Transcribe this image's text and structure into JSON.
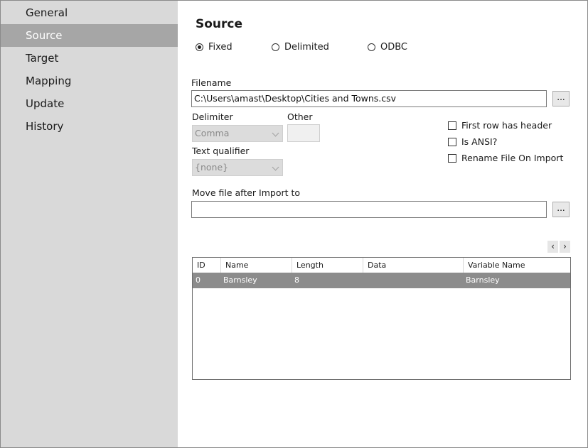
{
  "sidebar": {
    "items": [
      {
        "label": "General"
      },
      {
        "label": "Source",
        "selected": true
      },
      {
        "label": "Target"
      },
      {
        "label": "Mapping"
      },
      {
        "label": "Update"
      },
      {
        "label": "History"
      }
    ]
  },
  "source": {
    "title": "Source",
    "types": [
      {
        "label": "Fixed",
        "checked": true
      },
      {
        "label": "Delimited",
        "checked": false
      },
      {
        "label": "ODBC",
        "checked": false
      }
    ],
    "filename_label": "Filename",
    "filename_value": "C:\\Users\\amast\\Desktop\\Cities and Towns.csv",
    "browse_label": "...",
    "delimiter_label": "Delimiter",
    "delimiter_value": "Comma",
    "other_label": "Other",
    "text_qualifier_label": "Text qualifier",
    "text_qualifier_value": "{none}",
    "options": [
      {
        "label": "First row has header",
        "checked": false
      },
      {
        "label": "Is ANSI?",
        "checked": false
      },
      {
        "label": "Rename File On Import",
        "checked": false
      }
    ],
    "move_label": "Move file after Import to",
    "move_value": "",
    "move_browse_label": "...",
    "pager": {
      "prev": "‹",
      "next": "›"
    }
  },
  "grid": {
    "columns": [
      "ID",
      "Name",
      "Length",
      "Data",
      "Variable Name"
    ],
    "rows": [
      {
        "id": "0",
        "name": "Barnsley",
        "length": "8",
        "data": "",
        "variable_name": "Barnsley"
      }
    ]
  },
  "colors": {
    "sidebar_bg": "#d9d9d9",
    "selected_nav": "#a6a6a6",
    "selected_row": "#8c8c8c"
  }
}
